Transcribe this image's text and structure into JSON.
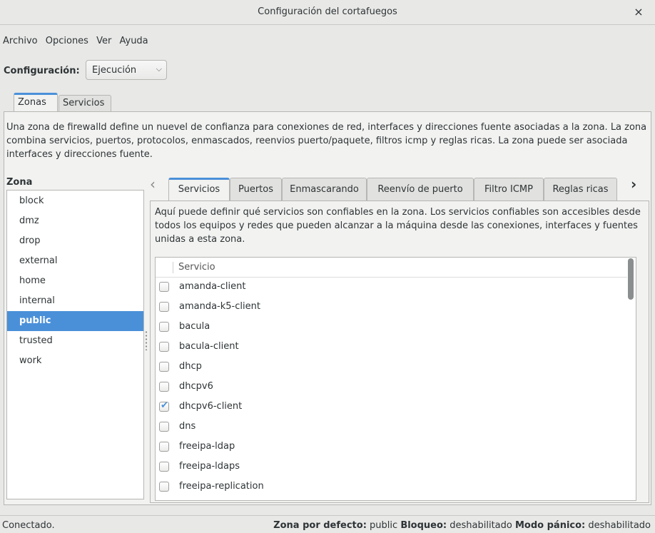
{
  "window": {
    "title": "Configuración del cortafuegos",
    "close_label": "×"
  },
  "menubar": {
    "items": [
      "Archivo",
      "Opciones",
      "Ver",
      "Ayuda"
    ]
  },
  "config": {
    "label": "Configuración:",
    "selected": "Ejecución",
    "chevron": "⌵"
  },
  "outer_tabs": [
    {
      "label": "Zonas",
      "active": true
    },
    {
      "label": "Servicios",
      "active": false
    }
  ],
  "zones_description": "Una zona de firewalld define un nuevel de confianza para conexiones de red, interfaces y direcciones fuente asociadas a la zona. La zona combina servicios, puertos, protocolos, enmascados, reenvios puerto/paquete, filtros icmp y reglas ricas. La zona puede ser asociada interfaces y direcciones fuente.",
  "zone_list": {
    "header": "Zona",
    "items": [
      "block",
      "dmz",
      "drop",
      "external",
      "home",
      "internal",
      "public",
      "trusted",
      "work"
    ],
    "selected": "public"
  },
  "inner_tabs": {
    "left_arrow": "‹",
    "right_arrow": "›",
    "items": [
      {
        "label": "Servicios",
        "active": true
      },
      {
        "label": "Puertos",
        "active": false
      },
      {
        "label": "Enmascarando",
        "active": false
      },
      {
        "label": "Reenvío de puerto",
        "active": false
      },
      {
        "label": "Filtro ICMP",
        "active": false
      },
      {
        "label": "Reglas ricas",
        "active": false
      }
    ]
  },
  "services_description": "Aquí puede definir qué servicios son confiables en la zona. Los servicios confiables son accesibles desde todos los equipos y redes que pueden alcanzar a la máquina desde las conexiones, interfaces y fuentes unidas a esta zona.",
  "services": {
    "column_header": "Servicio",
    "rows": [
      {
        "name": "amanda-client",
        "checked": false
      },
      {
        "name": "amanda-k5-client",
        "checked": false
      },
      {
        "name": "bacula",
        "checked": false
      },
      {
        "name": "bacula-client",
        "checked": false
      },
      {
        "name": "dhcp",
        "checked": false
      },
      {
        "name": "dhcpv6",
        "checked": false
      },
      {
        "name": "dhcpv6-client",
        "checked": true
      },
      {
        "name": "dns",
        "checked": false
      },
      {
        "name": "freeipa-ldap",
        "checked": false
      },
      {
        "name": "freeipa-ldaps",
        "checked": false
      },
      {
        "name": "freeipa-replication",
        "checked": false
      }
    ]
  },
  "statusbar": {
    "left": "Conectado.",
    "default_zone_label": "Zona por defecto:",
    "default_zone_value": "public",
    "lockdown_label": "Bloqueo:",
    "lockdown_value": "deshabilitado",
    "panic_label": "Modo pánico:",
    "panic_value": "deshabilitado"
  },
  "colors": {
    "accent": "#4a90d9",
    "window_bg": "#e8e8e7",
    "panel_bg": "#f2f2f1"
  }
}
